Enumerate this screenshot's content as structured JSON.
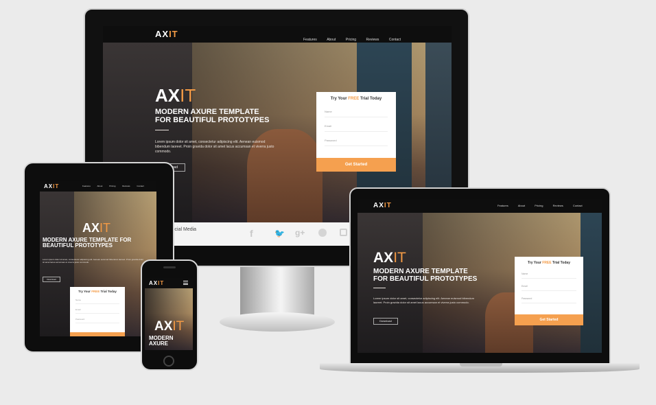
{
  "brand": {
    "logo_main": "AX",
    "logo_accent": "IT",
    "accent_color": "#f39a45"
  },
  "nav": {
    "items": [
      "Features",
      "About",
      "Pricing",
      "Reviews",
      "Contact"
    ]
  },
  "hero": {
    "title_main": "AX",
    "title_accent": "IT",
    "subtitle_line1": "MODERN AXURE TEMPLATE",
    "subtitle_line2": "FOR BEAUTIFUL PROTOTYPES",
    "body": "Lorem ipsum dolor sit amet, consectetur adipiscing elit. Aenean euismod bibendum laoreet. Proin gravida dolor sit amet lacus accumsan et viverra justo commodo.",
    "button": "Download"
  },
  "form": {
    "title_before": "Try Your",
    "title_free": "FREE",
    "title_after": "Trial Today",
    "name_placeholder": "Name",
    "email_placeholder": "Email",
    "password_placeholder": "Password",
    "submit": "Get Started"
  },
  "social": {
    "heading": "Social Media",
    "icons": [
      "facebook-icon",
      "twitter-icon",
      "google-plus-icon",
      "pinterest-icon",
      "instagram-icon"
    ]
  },
  "mobile": {
    "subtitle_line1": "MODERN",
    "subtitle_line2": "AXURE"
  },
  "tablet": {
    "subtitle_line1": "MODERN AXURE TEMPLATE FOR",
    "subtitle_line2": "BEAUTIFUL PROTOTYPES"
  }
}
